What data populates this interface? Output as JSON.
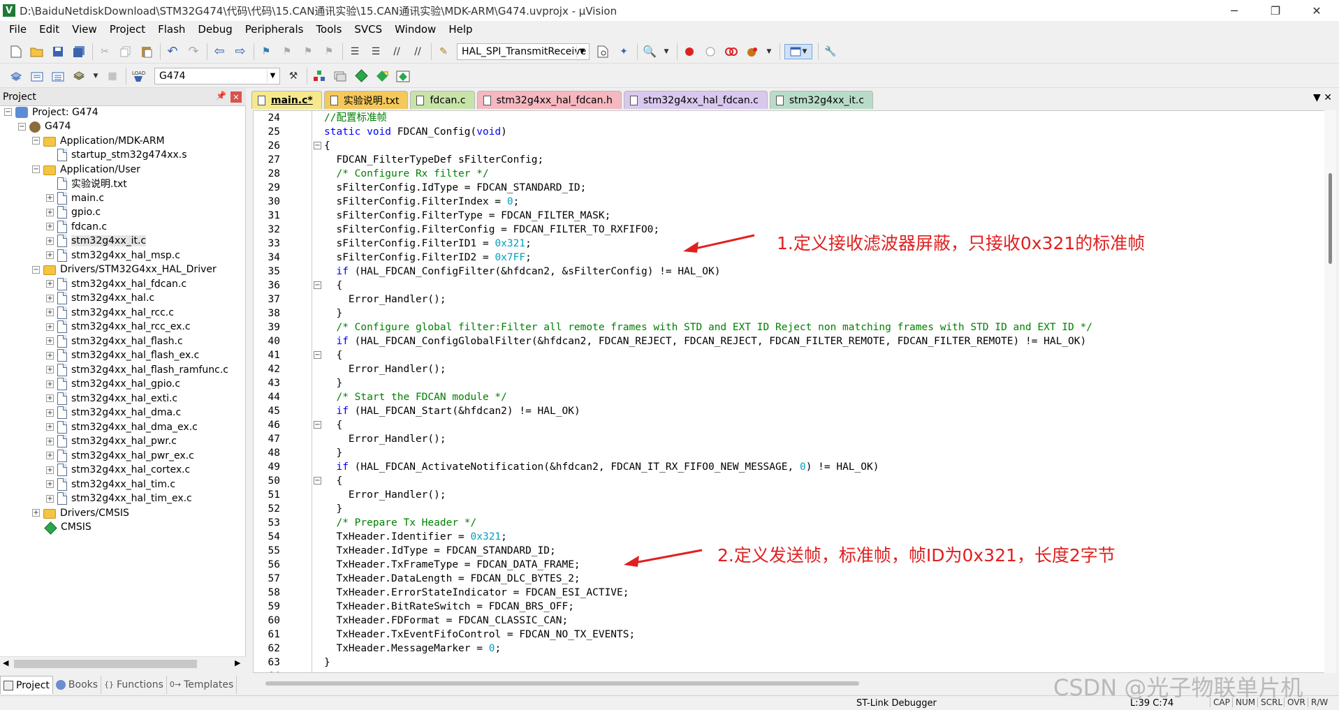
{
  "window": {
    "title": "D:\\BaiduNetdiskDownload\\STM32G474\\代码\\代码\\15.CAN通讯实验\\15.CAN通讯实验\\MDK-ARM\\G474.uvprojx - µVision",
    "app_icon": "V",
    "minimize": "─",
    "restore": "❐",
    "close": "✕"
  },
  "menu": [
    "File",
    "Edit",
    "View",
    "Project",
    "Flash",
    "Debug",
    "Peripherals",
    "Tools",
    "SVCS",
    "Window",
    "Help"
  ],
  "toolbar": {
    "function_combo": "HAL_SPI_TransmitReceive",
    "target_combo": "G474"
  },
  "project_panel": {
    "title": "Project",
    "pin": "📌",
    "close": "✕",
    "tree": [
      {
        "label": "Project: G474",
        "level": 0,
        "expander": "⊟",
        "icon": "proj"
      },
      {
        "label": "G474",
        "level": 1,
        "expander": "⊟",
        "icon": "gear"
      },
      {
        "label": "Application/MDK-ARM",
        "level": 2,
        "expander": "⊟",
        "icon": "folder"
      },
      {
        "label": "startup_stm32g474xx.s",
        "level": 3,
        "expander": "",
        "icon": "file"
      },
      {
        "label": "Application/User",
        "level": 2,
        "expander": "⊟",
        "icon": "folder"
      },
      {
        "label": "实验说明.txt",
        "level": 3,
        "expander": "",
        "icon": "file"
      },
      {
        "label": "main.c",
        "level": 3,
        "expander": "⊞",
        "icon": "file"
      },
      {
        "label": "gpio.c",
        "level": 3,
        "expander": "⊞",
        "icon": "file"
      },
      {
        "label": "fdcan.c",
        "level": 3,
        "expander": "⊞",
        "icon": "file"
      },
      {
        "label": "stm32g4xx_it.c",
        "level": 3,
        "expander": "⊞",
        "icon": "file",
        "selected": true
      },
      {
        "label": "stm32g4xx_hal_msp.c",
        "level": 3,
        "expander": "⊞",
        "icon": "file"
      },
      {
        "label": "Drivers/STM32G4xx_HAL_Driver",
        "level": 2,
        "expander": "⊟",
        "icon": "folder"
      },
      {
        "label": "stm32g4xx_hal_fdcan.c",
        "level": 3,
        "expander": "⊞",
        "icon": "file"
      },
      {
        "label": "stm32g4xx_hal.c",
        "level": 3,
        "expander": "⊞",
        "icon": "file"
      },
      {
        "label": "stm32g4xx_hal_rcc.c",
        "level": 3,
        "expander": "⊞",
        "icon": "file"
      },
      {
        "label": "stm32g4xx_hal_rcc_ex.c",
        "level": 3,
        "expander": "⊞",
        "icon": "file"
      },
      {
        "label": "stm32g4xx_hal_flash.c",
        "level": 3,
        "expander": "⊞",
        "icon": "file"
      },
      {
        "label": "stm32g4xx_hal_flash_ex.c",
        "level": 3,
        "expander": "⊞",
        "icon": "file"
      },
      {
        "label": "stm32g4xx_hal_flash_ramfunc.c",
        "level": 3,
        "expander": "⊞",
        "icon": "file"
      },
      {
        "label": "stm32g4xx_hal_gpio.c",
        "level": 3,
        "expander": "⊞",
        "icon": "file"
      },
      {
        "label": "stm32g4xx_hal_exti.c",
        "level": 3,
        "expander": "⊞",
        "icon": "file"
      },
      {
        "label": "stm32g4xx_hal_dma.c",
        "level": 3,
        "expander": "⊞",
        "icon": "file"
      },
      {
        "label": "stm32g4xx_hal_dma_ex.c",
        "level": 3,
        "expander": "⊞",
        "icon": "file"
      },
      {
        "label": "stm32g4xx_hal_pwr.c",
        "level": 3,
        "expander": "⊞",
        "icon": "file"
      },
      {
        "label": "stm32g4xx_hal_pwr_ex.c",
        "level": 3,
        "expander": "⊞",
        "icon": "file"
      },
      {
        "label": "stm32g4xx_hal_cortex.c",
        "level": 3,
        "expander": "⊞",
        "icon": "file"
      },
      {
        "label": "stm32g4xx_hal_tim.c",
        "level": 3,
        "expander": "⊞",
        "icon": "file"
      },
      {
        "label": "stm32g4xx_hal_tim_ex.c",
        "level": 3,
        "expander": "⊞",
        "icon": "file"
      },
      {
        "label": "Drivers/CMSIS",
        "level": 2,
        "expander": "⊞",
        "icon": "folder"
      },
      {
        "label": "CMSIS",
        "level": 2,
        "expander": "",
        "icon": "diamond"
      }
    ],
    "bottom_tabs": [
      "Project",
      "Books",
      "Functions",
      "Templates"
    ],
    "bottom_tab_icons": [
      "{}",
      "0→"
    ]
  },
  "editor_tabs": [
    {
      "label": "main.c*",
      "color": "#f5e98c",
      "active": true
    },
    {
      "label": "实验说明.txt",
      "color": "#f5c85a"
    },
    {
      "label": "fdcan.c",
      "color": "#c8e3a8"
    },
    {
      "label": "stm32g4xx_hal_fdcan.h",
      "color": "#f5b8c0"
    },
    {
      "label": "stm32g4xx_hal_fdcan.c",
      "color": "#d9c8ee"
    },
    {
      "label": "stm32g4xx_it.c",
      "color": "#b9dcc8"
    }
  ],
  "editor_tab_controls": "▼  ✕",
  "code_lines": [
    {
      "n": "24",
      "t": "//配置标准帧",
      "c": "cm"
    },
    {
      "n": "25",
      "t": "static void FDCAN_Config(void)",
      "c": "",
      "segs": [
        [
          "static void",
          "kw"
        ],
        [
          " FDCAN_Config(",
          ""
        ],
        [
          "void",
          "kw"
        ],
        [
          ")",
          ""
        ]
      ]
    },
    {
      "n": "26",
      "t": "{",
      "fold": "⊟"
    },
    {
      "n": "27",
      "t": "  FDCAN_FilterTypeDef sFilterConfig;"
    },
    {
      "n": "28",
      "t": "  /* Configure Rx filter */",
      "c": "cm"
    },
    {
      "n": "29",
      "t": "  sFilterConfig.IdType = FDCAN_STANDARD_ID;"
    },
    {
      "n": "30",
      "t": "  sFilterConfig.FilterIndex = 0;",
      "segs": [
        [
          "  sFilterConfig.FilterIndex = ",
          ""
        ],
        [
          "0",
          "nm"
        ],
        [
          ";",
          ""
        ]
      ]
    },
    {
      "n": "31",
      "t": "  sFilterConfig.FilterType = FDCAN_FILTER_MASK;"
    },
    {
      "n": "32",
      "t": "  sFilterConfig.FilterConfig = FDCAN_FILTER_TO_RXFIFO0;"
    },
    {
      "n": "33",
      "t": "  sFilterConfig.FilterID1 = 0x321;",
      "segs": [
        [
          "  sFilterConfig.FilterID1 = ",
          ""
        ],
        [
          "0x321",
          "nm"
        ],
        [
          ";",
          ""
        ]
      ]
    },
    {
      "n": "34",
      "t": "  sFilterConfig.FilterID2 = 0x7FF;",
      "segs": [
        [
          "  sFilterConfig.FilterID2 = ",
          ""
        ],
        [
          "0x7FF",
          "nm"
        ],
        [
          ";",
          ""
        ]
      ]
    },
    {
      "n": "35",
      "t": "  if (HAL_FDCAN_ConfigFilter(&hfdcan2, &sFilterConfig) != HAL_OK)",
      "segs": [
        [
          "  ",
          ""
        ],
        [
          "if",
          "kw"
        ],
        [
          " (HAL_FDCAN_ConfigFilter(&hfdcan2, &sFilterConfig) != HAL_OK)",
          ""
        ]
      ]
    },
    {
      "n": "36",
      "t": "  {",
      "fold": "⊟"
    },
    {
      "n": "37",
      "t": "    Error_Handler();"
    },
    {
      "n": "38",
      "t": "  }"
    },
    {
      "n": "39",
      "t": "  /* Configure global filter:Filter all remote frames with STD and EXT ID Reject non matching frames with STD ID and EXT ID */",
      "c": "cm"
    },
    {
      "n": "40",
      "t": "  if (HAL_FDCAN_ConfigGlobalFilter(&hfdcan2, FDCAN_REJECT, FDCAN_REJECT, FDCAN_FILTER_REMOTE, FDCAN_FILTER_REMOTE) != HAL_OK)",
      "segs": [
        [
          "  ",
          ""
        ],
        [
          "if",
          "kw"
        ],
        [
          " (HAL_FDCAN_ConfigGlobalFilter(&hfdcan2, FDCAN_REJECT, FDCAN_REJECT, FDCAN_FILTER_REMOTE, FDCAN_FILTER_REMOTE) != HAL_OK)",
          ""
        ]
      ]
    },
    {
      "n": "41",
      "t": "  {",
      "fold": "⊟"
    },
    {
      "n": "42",
      "t": "    Error_Handler();"
    },
    {
      "n": "43",
      "t": "  }"
    },
    {
      "n": "44",
      "t": "  /* Start the FDCAN module */",
      "c": "cm"
    },
    {
      "n": "45",
      "t": "  if (HAL_FDCAN_Start(&hfdcan2) != HAL_OK)",
      "segs": [
        [
          "  ",
          ""
        ],
        [
          "if",
          "kw"
        ],
        [
          " (HAL_FDCAN_Start(&hfdcan2) != HAL_OK)",
          ""
        ]
      ]
    },
    {
      "n": "46",
      "t": "  {",
      "fold": "⊟"
    },
    {
      "n": "47",
      "t": "    Error_Handler();"
    },
    {
      "n": "48",
      "t": "  }"
    },
    {
      "n": "49",
      "t": "  if (HAL_FDCAN_ActivateNotification(&hfdcan2, FDCAN_IT_RX_FIFO0_NEW_MESSAGE, 0) != HAL_OK)",
      "segs": [
        [
          "  ",
          ""
        ],
        [
          "if",
          "kw"
        ],
        [
          " (HAL_FDCAN_ActivateNotification(&hfdcan2, FDCAN_IT_RX_FIFO0_NEW_MESSAGE, ",
          ""
        ],
        [
          "0",
          "nm"
        ],
        [
          ") != HAL_OK)",
          ""
        ]
      ]
    },
    {
      "n": "50",
      "t": "  {",
      "fold": "⊟"
    },
    {
      "n": "51",
      "t": "    Error_Handler();"
    },
    {
      "n": "52",
      "t": "  }"
    },
    {
      "n": "53",
      "t": "  /* Prepare Tx Header */",
      "c": "cm"
    },
    {
      "n": "54",
      "t": "  TxHeader.Identifier = 0x321;",
      "segs": [
        [
          "  TxHeader.Identifier = ",
          ""
        ],
        [
          "0x321",
          "nm"
        ],
        [
          ";",
          ""
        ]
      ]
    },
    {
      "n": "55",
      "t": "  TxHeader.IdType = FDCAN_STANDARD_ID;"
    },
    {
      "n": "56",
      "t": "  TxHeader.TxFrameType = FDCAN_DATA_FRAME;"
    },
    {
      "n": "57",
      "t": "  TxHeader.DataLength = FDCAN_DLC_BYTES_2;"
    },
    {
      "n": "58",
      "t": "  TxHeader.ErrorStateIndicator = FDCAN_ESI_ACTIVE;"
    },
    {
      "n": "59",
      "t": "  TxHeader.BitRateSwitch = FDCAN_BRS_OFF;"
    },
    {
      "n": "60",
      "t": "  TxHeader.FDFormat = FDCAN_CLASSIC_CAN;"
    },
    {
      "n": "61",
      "t": "  TxHeader.TxEventFifoControl = FDCAN_NO_TX_EVENTS;"
    },
    {
      "n": "62",
      "t": "  TxHeader.MessageMarker = 0;",
      "segs": [
        [
          "  TxHeader.MessageMarker = ",
          ""
        ],
        [
          "0",
          "nm"
        ],
        [
          ";",
          ""
        ]
      ]
    },
    {
      "n": "63",
      "t": "}"
    },
    {
      "n": "64",
      "t": ""
    }
  ],
  "annotations": {
    "note1": "1.定义接收滤波器屏蔽，只接收0x321的标准帧",
    "note2": "2.定义发送帧，标准帧，帧ID为0x321，长度2字节",
    "color": "#e02020"
  },
  "status": {
    "debugger": "ST-Link Debugger",
    "position": "L:39 C:74",
    "keys": [
      "CAP",
      "NUM",
      "SCRL",
      "OVR",
      "R/W"
    ]
  },
  "watermark": "CSDN @光子物联单片机"
}
